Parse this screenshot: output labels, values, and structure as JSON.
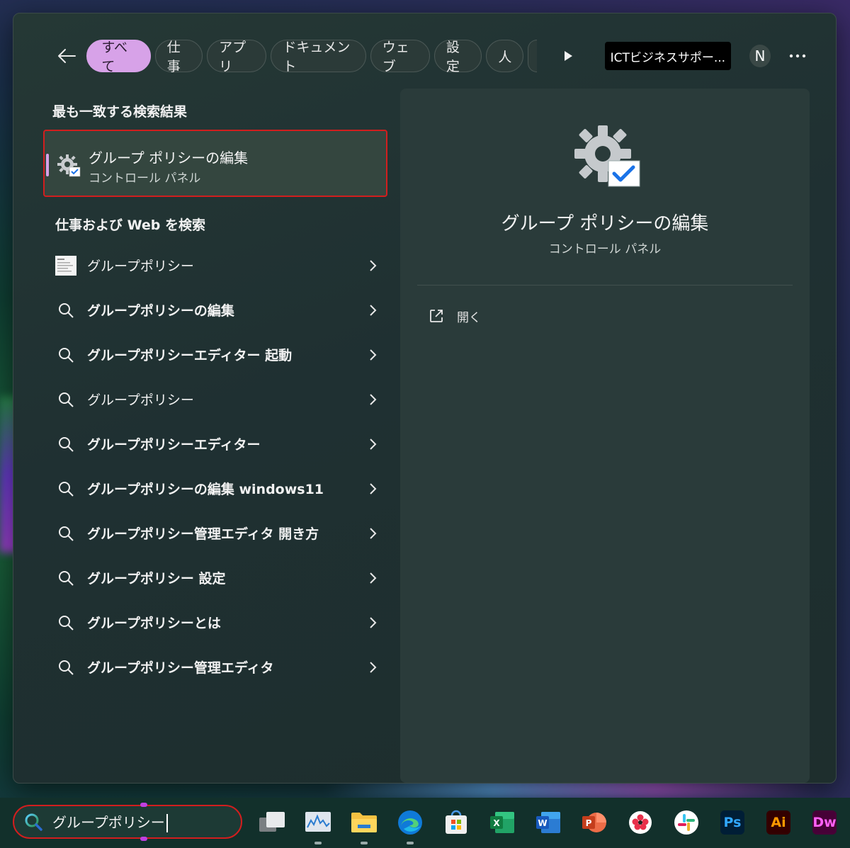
{
  "filters": {
    "back_label": "←",
    "chips": [
      "すべて",
      "仕事",
      "アプリ",
      "ドキュメント",
      "ウェブ",
      "設定",
      "人"
    ],
    "org_badge": "ICTビジネスサポー...",
    "avatar_initial": "N",
    "accent_color": "#d7a2e8"
  },
  "best_match": {
    "section_title": "最も一致する検索結果",
    "title": "グループ ポリシーの編集",
    "subtitle": "コントロール パネル"
  },
  "web_search": {
    "section_title": "仕事および Web を検索",
    "items": [
      "グループポリシー",
      "グループポリシーの編集",
      "グループポリシーエディター 起動",
      "グループポリシー",
      "グループポリシーエディター",
      "グループポリシーの編集 windows11",
      "グループポリシー管理エディタ 開き方",
      "グループポリシー 設定",
      "グループポリシーとは",
      "グループポリシー管理エディタ"
    ]
  },
  "preview": {
    "title": "グループ ポリシーの編集",
    "subtitle": "コントロール パネル",
    "open_label": "開く"
  },
  "taskbar": {
    "search_value": "グループポリシー",
    "apps": [
      "task-view",
      "task-manager",
      "file-explorer",
      "edge",
      "store",
      "excel",
      "word",
      "powerpoint",
      "photos-app",
      "slack",
      "photoshop",
      "illustrator",
      "dreamweaver"
    ],
    "adobe_labels": {
      "ps": "Ps",
      "ai": "Ai",
      "dw": "Dw"
    }
  }
}
